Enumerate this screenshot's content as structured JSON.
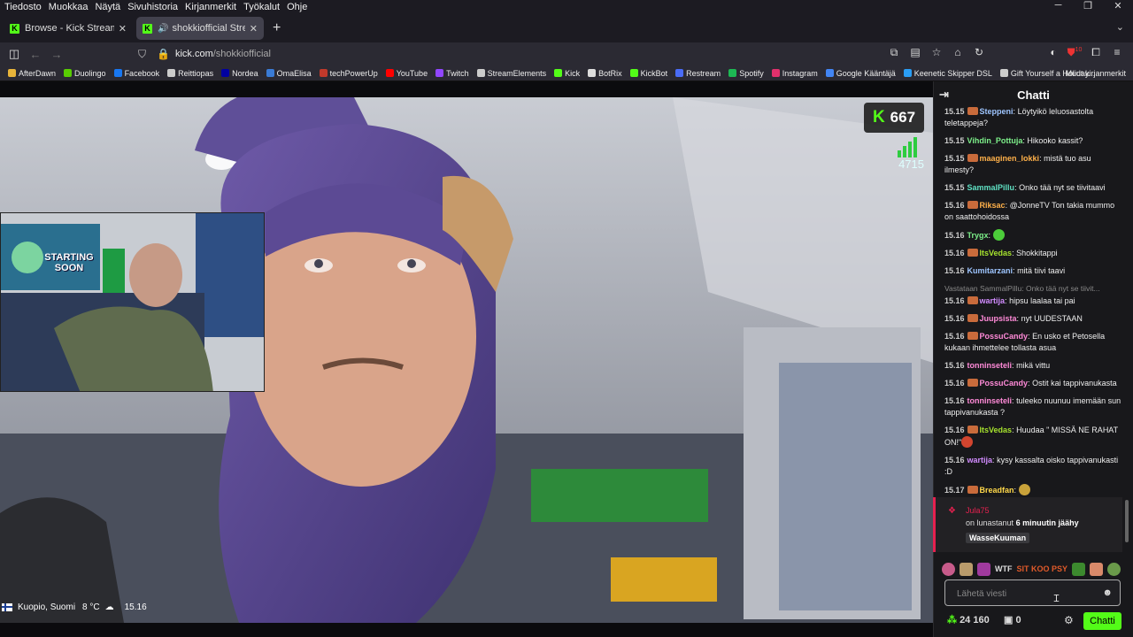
{
  "menubar": {
    "items": [
      "Tiedosto",
      "Muokkaa",
      "Näytä",
      "Sivuhistoria",
      "Kirjanmerkit",
      "Työkalut",
      "Ohje"
    ]
  },
  "tabs": [
    {
      "label": "Browse - Kick Streaming",
      "active": false
    },
    {
      "label": "shokkiofficial Stream - Wat",
      "active": true
    }
  ],
  "url": {
    "host": "kick.com",
    "path": "/shokkiofficial"
  },
  "toolbar": {
    "badge": "10"
  },
  "bookmarks": [
    {
      "label": "AfterDawn",
      "color": "#e8b43a"
    },
    {
      "label": "Duolingo",
      "color": "#58cc02"
    },
    {
      "label": "Facebook",
      "color": "#1877f2"
    },
    {
      "label": "Reittiopas",
      "color": "#cccccc"
    },
    {
      "label": "Nordea",
      "color": "#0000a0"
    },
    {
      "label": "OmaElisa",
      "color": "#3a7bd5"
    },
    {
      "label": "techPowerUp",
      "color": "#c0392b"
    },
    {
      "label": "YouTube",
      "color": "#ff0000"
    },
    {
      "label": "Twitch",
      "color": "#9146ff"
    },
    {
      "label": "StreamElements",
      "color": "#cccccc"
    },
    {
      "label": "Kick",
      "color": "#53fc18"
    },
    {
      "label": "BotRix",
      "color": "#dddddd"
    },
    {
      "label": "KickBot",
      "color": "#53fc18"
    },
    {
      "label": "Restream",
      "color": "#4a6cf7"
    },
    {
      "label": "Spotify",
      "color": "#1db954"
    },
    {
      "label": "Instagram",
      "color": "#e1306c"
    },
    {
      "label": "Google Kääntäjä",
      "color": "#4285f4"
    },
    {
      "label": "Keenetic Skipper DSL",
      "color": "#2a9df4"
    },
    {
      "label": "Gift Yourself a Holiday...",
      "color": "#cccccc"
    }
  ],
  "bookmarks_other": "Muut kirjanmerkit",
  "stream": {
    "viewers": "667",
    "signal_count": "4715",
    "location": "Kuopio, Suomi",
    "temperature": "8 °C",
    "time": "15.16",
    "overlay_text": "STARTING SOON"
  },
  "chat": {
    "title": "Chatti",
    "messages": [
      {
        "time": "15.15",
        "user": "Steppeni",
        "color": "#9ec5ff",
        "text": "Löytyikö leluosastolta teletappeja?"
      },
      {
        "time": "15.15",
        "user": "Vihdin_Pottuja",
        "color": "#7df08a",
        "text": "Hikooko kassit?"
      },
      {
        "time": "15.15",
        "user": "maaginen_lokki",
        "color": "#ffb14a",
        "text": "mistä tuo asu ilmesty?"
      },
      {
        "time": "15.15",
        "user": "SammalPillu",
        "color": "#5fe0c3",
        "text": "Onko tää nyt se tiivitaavi"
      },
      {
        "time": "15.16",
        "user": "Riksac",
        "color": "#ffb14a",
        "text": "@JonneTV Ton takia mummo on saattohoidossa"
      },
      {
        "time": "15.16",
        "user": "Trygx",
        "color": "#7df08a",
        "text": ""
      },
      {
        "time": "15.16",
        "user": "ItsVedas",
        "color": "#a6e22e",
        "text": "Shokkitappi"
      },
      {
        "time": "15.16",
        "user": "Kumitarzani",
        "color": "#9ec5ff",
        "text": "mitä tiivi taavi"
      },
      {
        "time": "15.16",
        "user": "wartija",
        "color": "#d28cff",
        "text": "hipsu laalaa tai pai",
        "reply": "Vastataan SammalPillu: Onko tää nyt se tiivit..."
      },
      {
        "time": "15.16",
        "user": "Juupsista",
        "color": "#ff8ad8",
        "text": "nyt UUDESTAAN"
      },
      {
        "time": "15.16",
        "user": "PossuCandy",
        "color": "#ff8ad8",
        "text": "En usko et Petosella kukaan ihmettelee tollasta asua"
      },
      {
        "time": "15.16",
        "user": "tonninseteli",
        "color": "#ff8ad8",
        "text": "mikä vittu"
      },
      {
        "time": "15.16",
        "user": "PossuCandy",
        "color": "#ff8ad8",
        "text": "Ostit kai tappivanukasta"
      },
      {
        "time": "15.16",
        "user": "tonninseteli",
        "color": "#ff8ad8",
        "text": "tuleeko nuunuu imemään sun tappivanukasta ?"
      },
      {
        "time": "15.16",
        "user": "ItsVedas",
        "color": "#a6e22e",
        "text": "Huudaa \" MISSÄ NE RAHAT ON!\""
      },
      {
        "time": "15.16",
        "user": "wartija",
        "color": "#d28cff",
        "text": "kysy kassalta oisko tappivanukasti :D"
      },
      {
        "time": "15.17",
        "user": "Breadfan",
        "color": "#ffd84a",
        "text": ""
      }
    ],
    "redeem": {
      "user": "Jula75",
      "text_pre": "on lunastanut",
      "text_bold": "6 minuutin jäähy",
      "message": "WasseKuuman"
    },
    "emote_text": [
      "WTF",
      "SIT KOO PSY"
    ],
    "input_placeholder": "Lähetä viesti",
    "points": "24 160",
    "box_count": "0",
    "send_label": "Chatti"
  }
}
